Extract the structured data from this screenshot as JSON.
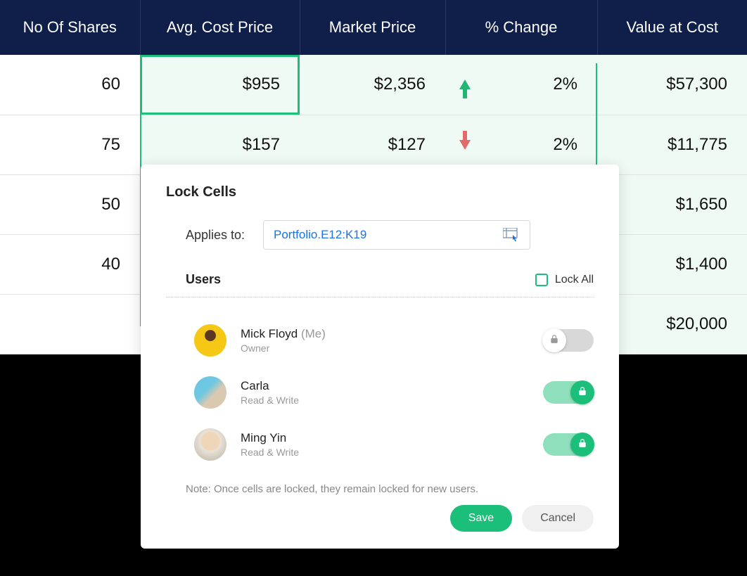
{
  "table": {
    "headers": [
      "No Of Shares",
      "Avg. Cost Price",
      "Market Price",
      "% Change",
      "Value at Cost"
    ],
    "rows": [
      {
        "shares": "60",
        "avg": "$955",
        "market": "$2,356",
        "dir": "up",
        "change": "2%",
        "value": "$57,300"
      },
      {
        "shares": "75",
        "avg": "$157",
        "market": "$127",
        "dir": "down",
        "change": "2%",
        "value": "$11,775"
      },
      {
        "shares": "50",
        "avg": "",
        "market": "",
        "dir": "",
        "change": "",
        "value": "$1,650"
      },
      {
        "shares": "40",
        "avg": "",
        "market": "",
        "dir": "",
        "change": "",
        "value": "$1,400"
      },
      {
        "shares": "",
        "avg": "",
        "market": "",
        "dir": "",
        "change": "",
        "value": "$20,000"
      }
    ]
  },
  "modal": {
    "title": "Lock Cells",
    "applies_label": "Applies to:",
    "applies_value": "Portfolio.E12:K19",
    "users_label": "Users",
    "lock_all_label": "Lock All",
    "users": [
      {
        "name": "Mick Floyd",
        "suffix": "(Me)",
        "role": "Owner",
        "locked": false
      },
      {
        "name": "Carla",
        "suffix": "",
        "role": "Read & Write",
        "locked": true
      },
      {
        "name": "Ming Yin",
        "suffix": "",
        "role": "Read & Write",
        "locked": true
      }
    ],
    "note": "Note: Once cells are locked, they remain locked for new users.",
    "save_label": "Save",
    "cancel_label": "Cancel"
  }
}
